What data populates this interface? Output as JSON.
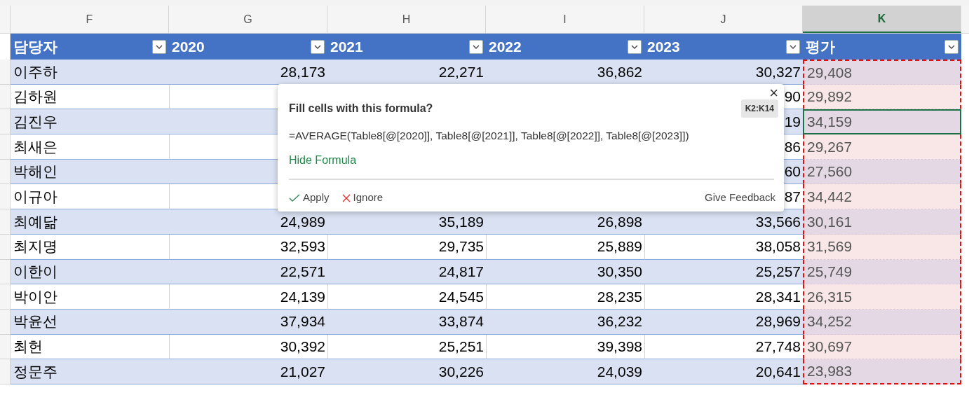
{
  "columns": [
    {
      "label": "F",
      "selected": false
    },
    {
      "label": "G",
      "selected": false
    },
    {
      "label": "H",
      "selected": false
    },
    {
      "label": "I",
      "selected": false
    },
    {
      "label": "J",
      "selected": false
    },
    {
      "label": "K",
      "selected": true
    }
  ],
  "headers": [
    "담당자",
    "2020",
    "2021",
    "2022",
    "2023",
    "평가"
  ],
  "rows": [
    {
      "name": "이주하",
      "values": [
        "28,173",
        "22,271",
        "36,862",
        "30,327"
      ],
      "average": "29,408",
      "selected": false
    },
    {
      "name": "김하원",
      "visible_tail": "90",
      "average": "29,892",
      "selected": false
    },
    {
      "name": "김진우",
      "visible_tail": "19",
      "average": "34,159",
      "selected": true
    },
    {
      "name": "최새은",
      "visible_tail": "86",
      "average": "29,267",
      "selected": false
    },
    {
      "name": "박해인",
      "visible_tail": "60",
      "average": "27,560",
      "selected": false
    },
    {
      "name": "이규아",
      "visible_tail": "87",
      "average": "34,442",
      "selected": false
    },
    {
      "name": "최예닮",
      "values": [
        "24,989",
        "35,189",
        "26,898",
        "33,566"
      ],
      "average": "30,161",
      "selected": false
    },
    {
      "name": "최지명",
      "values": [
        "32,593",
        "29,735",
        "25,889",
        "38,058"
      ],
      "average": "31,569",
      "selected": false
    },
    {
      "name": "이한이",
      "values": [
        "22,571",
        "24,817",
        "30,350",
        "25,257"
      ],
      "average": "25,749",
      "selected": false
    },
    {
      "name": "박이안",
      "values": [
        "24,139",
        "24,545",
        "28,235",
        "28,341"
      ],
      "average": "26,315",
      "selected": false
    },
    {
      "name": "박윤선",
      "values": [
        "37,934",
        "33,874",
        "36,232",
        "28,969"
      ],
      "average": "34,252",
      "selected": false
    },
    {
      "name": "최헌",
      "values": [
        "30,392",
        "25,251",
        "39,398",
        "27,748"
      ],
      "average": "30,697",
      "selected": false
    },
    {
      "name": "정문주",
      "values": [
        "21,027",
        "30,226",
        "24,039",
        "20,641"
      ],
      "average": "23,983",
      "selected": false
    }
  ],
  "popup": {
    "title": "Fill cells with this formula?",
    "range": "K2:K14",
    "formula": "=AVERAGE(Table8[@[2020]], Table8[@[2021]], Table8[@[2022]], Table8[@[2023]])",
    "toggle_link": "Hide Formula",
    "apply": "Apply",
    "ignore": "Ignore",
    "feedback": "Give Feedback",
    "close": "×"
  }
}
